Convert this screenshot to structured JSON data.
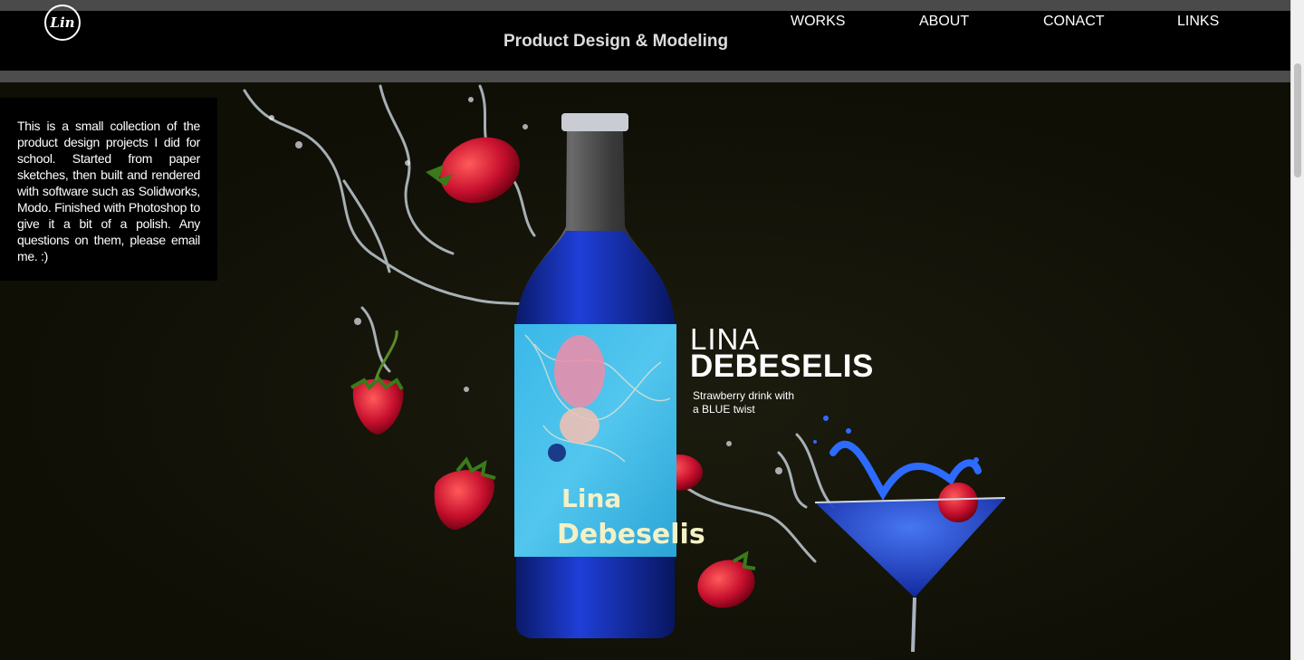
{
  "header": {
    "logo_text": "Lin",
    "title": "Product Design & Modeling",
    "nav": [
      "WORKS",
      "ABOUT",
      "CONACT",
      "LINKS"
    ]
  },
  "sidebar": {
    "description": "This is a small collection of the product design projects I did for school. Started from paper sketches, then built and rendered with software such as Solidworks, Modo. Finished with Photoshop to give it a bit of a polish. Any questions on them, please email me. :)"
  },
  "hero": {
    "brand_first": "LINA",
    "brand_last": "DEBESELIS",
    "tagline_line1": "Strawberry drink with",
    "tagline_line2": "a BLUE twist",
    "label_text_1": "Lina",
    "label_text_2": "Debeselis"
  },
  "colors": {
    "header_bg": "#000000",
    "bar_gray": "#4d4d4d",
    "hero_bg": "#11110a",
    "drink_blue": "#1f3fd8",
    "label_cyan": "#3ab8e8",
    "strawberry_red": "#c8102e"
  }
}
